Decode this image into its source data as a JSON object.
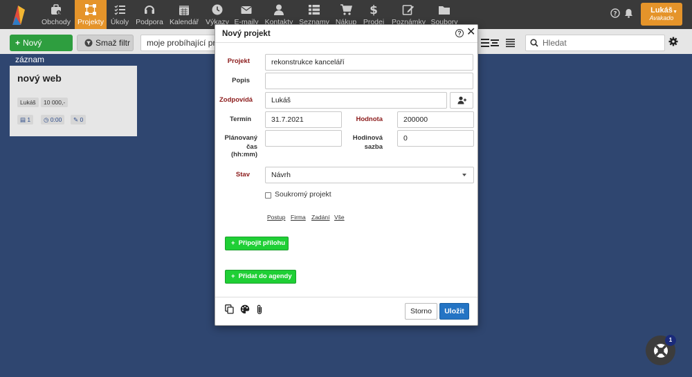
{
  "nav": {
    "items": [
      {
        "label": "Obchody",
        "icon": "briefcase-icon"
      },
      {
        "label": "Projekty",
        "icon": "projects-icon"
      },
      {
        "label": "Úkoly",
        "icon": "tasks-icon"
      },
      {
        "label": "Podpora",
        "icon": "headset-icon"
      },
      {
        "label": "Kalendář",
        "icon": "calendar-icon"
      },
      {
        "label": "Výkazy",
        "icon": "clock-icon"
      },
      {
        "label": "E-maily",
        "icon": "envelope-icon"
      },
      {
        "label": "Kontakty",
        "icon": "user-icon"
      },
      {
        "label": "Seznamy",
        "icon": "list-icon"
      },
      {
        "label": "Nákup",
        "icon": "cart-icon"
      },
      {
        "label": "Prodej",
        "icon": "dollar-icon"
      },
      {
        "label": "Poznámky",
        "icon": "edit-icon"
      },
      {
        "label": "Soubory",
        "icon": "folder-icon"
      }
    ],
    "active": "Projekty",
    "user_name": "Lukáš",
    "user_company": "Avakado"
  },
  "toolbar": {
    "new_record": "Nový záznam",
    "clear_filter": "Smaž filtr",
    "filter_value": "moje probíhající projekty",
    "search_placeholder": "Hledat"
  },
  "card": {
    "title": "nový web",
    "owner": "Lukáš",
    "value": "10 000,-",
    "count": "1",
    "time": "0:00",
    "notes": "0"
  },
  "modal": {
    "title": "Nový projekt",
    "labels": {
      "projekt": "Projekt",
      "popis": "Popis",
      "zodpovida": "Zodpovídá",
      "termin": "Termín",
      "hodnota": "Hodnota",
      "planovany_line1": "Plánovaný",
      "planovany_line2": "čas (hh:mm)",
      "hodinova_line1": "Hodinová",
      "hodinova_line2": "sazba",
      "stav": "Stav"
    },
    "values": {
      "projekt": "rekonstrukce kanceláří",
      "popis": "",
      "zodpovida": "Lukáš",
      "termin": "31.7.2021",
      "hodnota": "200000",
      "planovany": "",
      "hodinova": "0",
      "stav": "Návrh"
    },
    "private_label": "Soukromý projekt",
    "tabs": [
      "Postup",
      "Firma",
      "Zadání",
      "Vše"
    ],
    "attach_button": "Připojit přílohu",
    "agenda_button": "Přidat do agendy",
    "cancel": "Storno",
    "save": "Uložit"
  },
  "widget": {
    "badge": "1"
  },
  "colors": {
    "nav_bg": "#3a3a3a",
    "accent": "#e5942a",
    "page_bg": "#2f4670",
    "required_label": "#8b1a1a",
    "green_button": "#1fcf35",
    "save_blue": "#2474c4"
  }
}
